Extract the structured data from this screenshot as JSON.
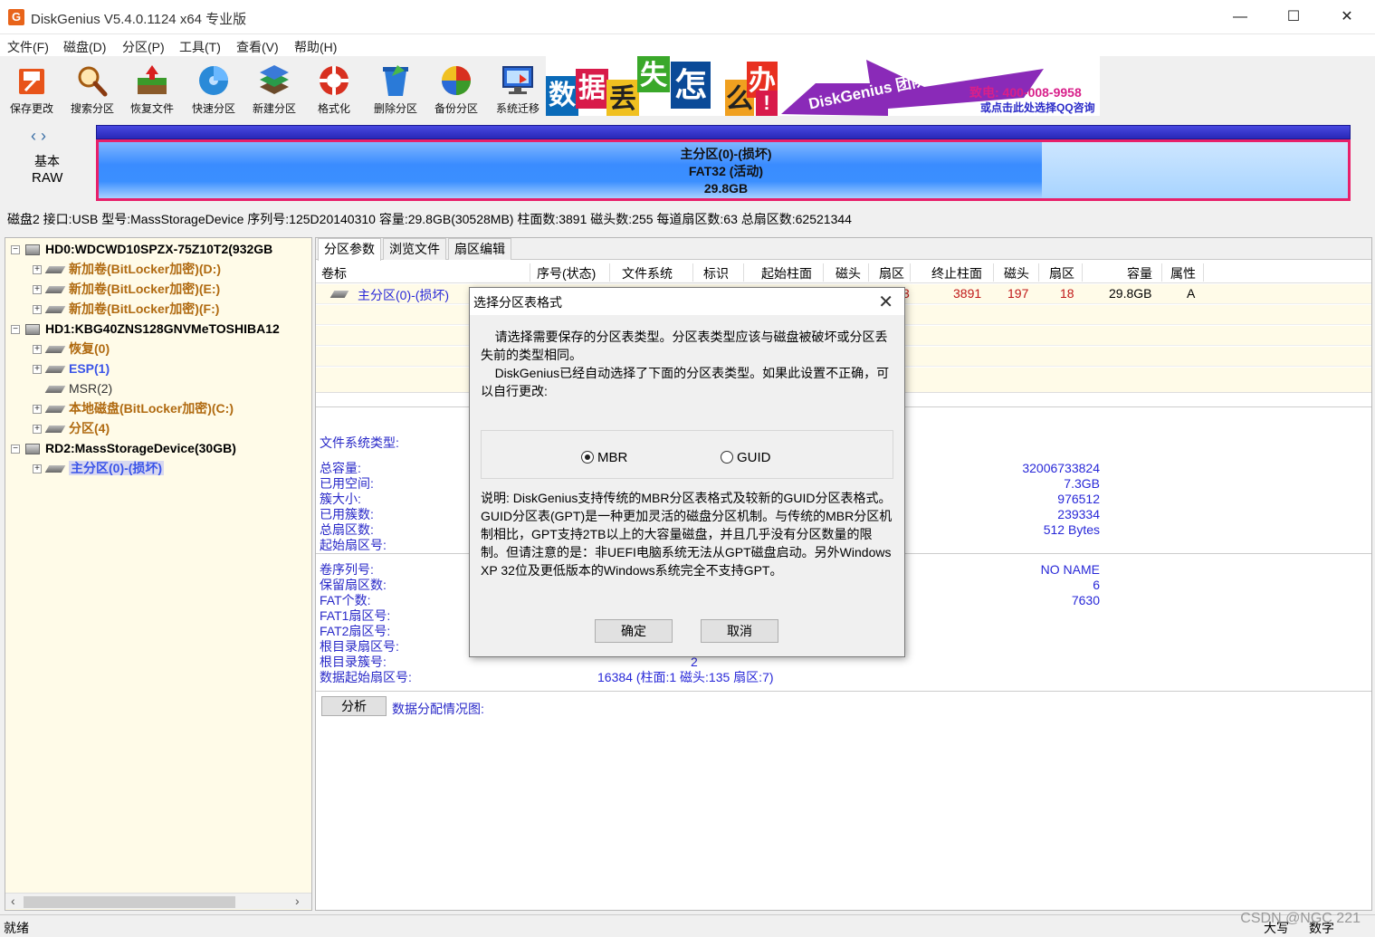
{
  "window": {
    "title": "DiskGenius V5.4.0.1124 x64 专业版",
    "app_icon": "G",
    "controls": [
      "—",
      "☐",
      "✕"
    ]
  },
  "menu": [
    "文件(F)",
    "磁盘(D)",
    "分区(P)",
    "工具(T)",
    "查看(V)",
    "帮助(H)"
  ],
  "toolbar": [
    {
      "label": "保存更改",
      "icon": "save-icon"
    },
    {
      "label": "搜索分区",
      "icon": "search-icon"
    },
    {
      "label": "恢复文件",
      "icon": "recover-icon"
    },
    {
      "label": "快速分区",
      "icon": "quick-partition-icon"
    },
    {
      "label": "新建分区",
      "icon": "new-partition-icon"
    },
    {
      "label": "格式化",
      "icon": "format-icon"
    },
    {
      "label": "删除分区",
      "icon": "delete-icon"
    },
    {
      "label": "备份分区",
      "icon": "backup-icon"
    },
    {
      "label": "系统迁移",
      "icon": "migrate-icon"
    }
  ],
  "banner": {
    "chars": [
      "数",
      "据",
      "丢",
      "失",
      "怎",
      "么",
      "办",
      "!"
    ],
    "slogan": "DiskGenius 团队为您服务",
    "phone": "致电: 400-008-9958",
    "qq": "或点击此处选择QQ咨询"
  },
  "disk_map": {
    "nav": "‹ ›",
    "type": "基本",
    "kind": "RAW",
    "partition_line1": "主分区(0)-(损坏)",
    "partition_line2": "FAT32 (活动)",
    "partition_line3": "29.8GB"
  },
  "disk_info": "磁盘2 接口:USB  型号:MassStorageDevice  序列号:125D20140310  容量:29.8GB(30528MB)  柱面数:3891  磁头数:255  每道扇区数:63  总扇区数:62521344",
  "tree": [
    {
      "label": "HD0:WDCWD10SPZX-75Z10T2(932GB",
      "kind": "disk"
    },
    {
      "label": "新加卷(BitLocker加密)(D:)",
      "kind": "vol"
    },
    {
      "label": "新加卷(BitLocker加密)(E:)",
      "kind": "vol"
    },
    {
      "label": "新加卷(BitLocker加密)(F:)",
      "kind": "vol"
    },
    {
      "label": "HD1:KBG40ZNS128GNVMeTOSHIBA12",
      "kind": "disk"
    },
    {
      "label": "恢复(0)",
      "kind": "vol"
    },
    {
      "label": "ESP(1)",
      "kind": "blue"
    },
    {
      "label": "MSR(2)",
      "kind": "grey"
    },
    {
      "label": "本地磁盘(BitLocker加密)(C:)",
      "kind": "vol"
    },
    {
      "label": "分区(4)",
      "kind": "vol"
    },
    {
      "label": "RD2:MassStorageDevice(30GB)",
      "kind": "disk"
    },
    {
      "label": "主分区(0)-(损坏)",
      "kind": "blue"
    }
  ],
  "tabs": [
    "分区参数",
    "浏览文件",
    "扇区编辑"
  ],
  "grid": {
    "headers": [
      "卷标",
      "序号(状态)",
      "文件系统",
      "标识",
      "起始柱面",
      "磁头",
      "扇区",
      "终止柱面",
      "磁头",
      "扇区",
      "容量",
      "属性"
    ],
    "row": {
      "label": "主分区(0)-(损坏)",
      "start_sector_partial": "3",
      "end_cyl": "3891",
      "end_head": "197",
      "end_sector": "18",
      "capacity": "29.8GB",
      "attr": "A"
    }
  },
  "info": {
    "fs_type_label": "文件系统类型:",
    "labels": [
      "总容量:",
      "已用空间:",
      "簇大小:",
      "已用簇数:",
      "总扇区数:",
      "起始扇区号:"
    ],
    "values": [
      "32006733824",
      "7.3GB",
      "976512",
      "239334",
      "512 Bytes",
      ""
    ],
    "labels2": [
      "卷序列号:",
      "保留扇区数:",
      "FAT个数:",
      "FAT1扇区号:",
      "FAT2扇区号:",
      "根目录扇区号:",
      "根目录簇号:",
      "数据起始扇区号:"
    ],
    "values2": [
      "NO NAME",
      "6",
      "7630"
    ],
    "root_cluster": "2",
    "data_start": "16384 (柱面:1 磁头:135 扇区:7)",
    "analyze_button": "分析",
    "alloc_label": "数据分配情况图:"
  },
  "status": {
    "text": "就绪",
    "caps": "大写",
    "num": "数字",
    "watermark": "CSDN @NGC 221"
  },
  "dialog": {
    "title": "选择分区表格式",
    "close": "✕",
    "intro": "    请选择需要保存的分区表类型。分区表类型应该与磁盘被破坏或分区丢失前的类型相同。\n    DiskGenius已经自动选择了下面的分区表类型。如果此设置不正确，可以自行更改:",
    "option_mbr": "MBR",
    "option_guid": "GUID",
    "selected": "MBR",
    "description": "说明: DiskGenius支持传统的MBR分区表格式及较新的GUID分区表格式。GUID分区表(GPT)是一种更加灵活的磁盘分区机制。与传统的MBR分区机制相比，GPT支持2TB以上的大容量磁盘，并且几乎没有分区数量的限制。但请注意的是：非UEFI电脑系统无法从GPT磁盘启动。另外Windows XP 32位及更低版本的Windows系统完全不支持GPT。",
    "ok": "确定",
    "cancel": "取消"
  }
}
